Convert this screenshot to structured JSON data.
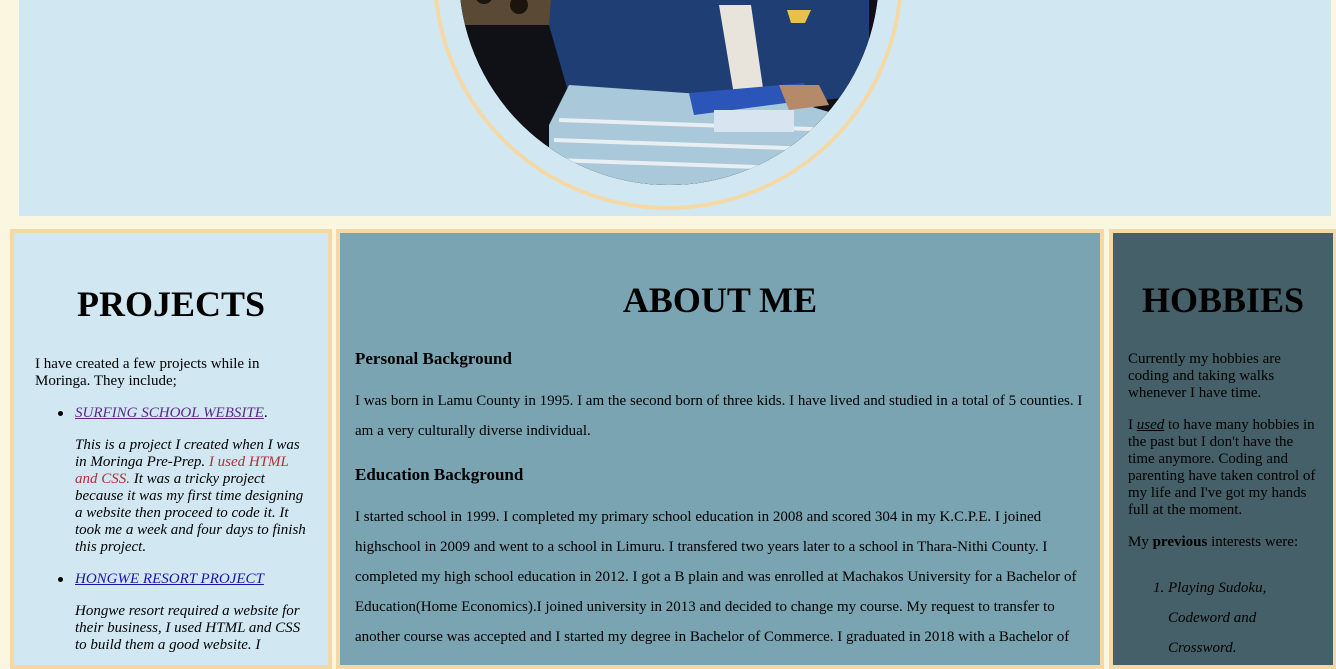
{
  "projects": {
    "heading": "PROJECTS",
    "intro": "I have created a few projects while in Moringa. They include;",
    "items": [
      {
        "link": "SURFING SCHOOL WEBSITE",
        "after_link": ".",
        "desc_before": "This is a project I created when I was in Moringa Pre-Prep.",
        "desc_highlight": "I used HTML and CSS.",
        "desc_after": "It was a tricky project because it was my first time designing a website then proceed to code it. It took me a week and four days to finish this project."
      },
      {
        "link": "HONGWE RESORT PROJECT",
        "desc": "Hongwe resort required a website for their business, I used HTML and CSS to build them a good website. I"
      }
    ]
  },
  "about": {
    "heading": "ABOUT ME",
    "personal_heading": "Personal Background",
    "personal_text": "I was born in Lamu County in 1995. I am the second born of three kids. I have lived and studied in a total of 5 counties. I am a very culturally diverse individual.",
    "education_heading": "Education Background",
    "education_text": "I started school in 1999. I completed my primary school education in 2008 and scored 304 in my K.C.P.E. I joined highschool in 2009 and went to a school in Limuru. I transfered two years later to a school in Thara-Nithi County. I completed my high school education in 2012. I got a B plain and was enrolled at Machakos University for a Bachelor of Education(Home Economics).I joined university in 2013 and decided to change my course. My request to transfer to another course was accepted and I started my degree in Bachelor of Commerce. I graduated in 2018 with a Bachelor of"
  },
  "hobbies": {
    "heading": "HOBBIES",
    "p1": "Currently my hobbies are coding and taking walks whenever I have time.",
    "p2_before": "I",
    "p2_link": "used",
    "p2_after": "to have many hobbies in the past but I don't have the time anymore. Coding and parenting have taken control of my life and I've got my hands full at the moment.",
    "p3_before": "My",
    "p3_bold": "previous",
    "p3_after": "interests were:",
    "list_marker": "1.",
    "list_item": "Playing Sudoku, Codeword and Crossword."
  }
}
